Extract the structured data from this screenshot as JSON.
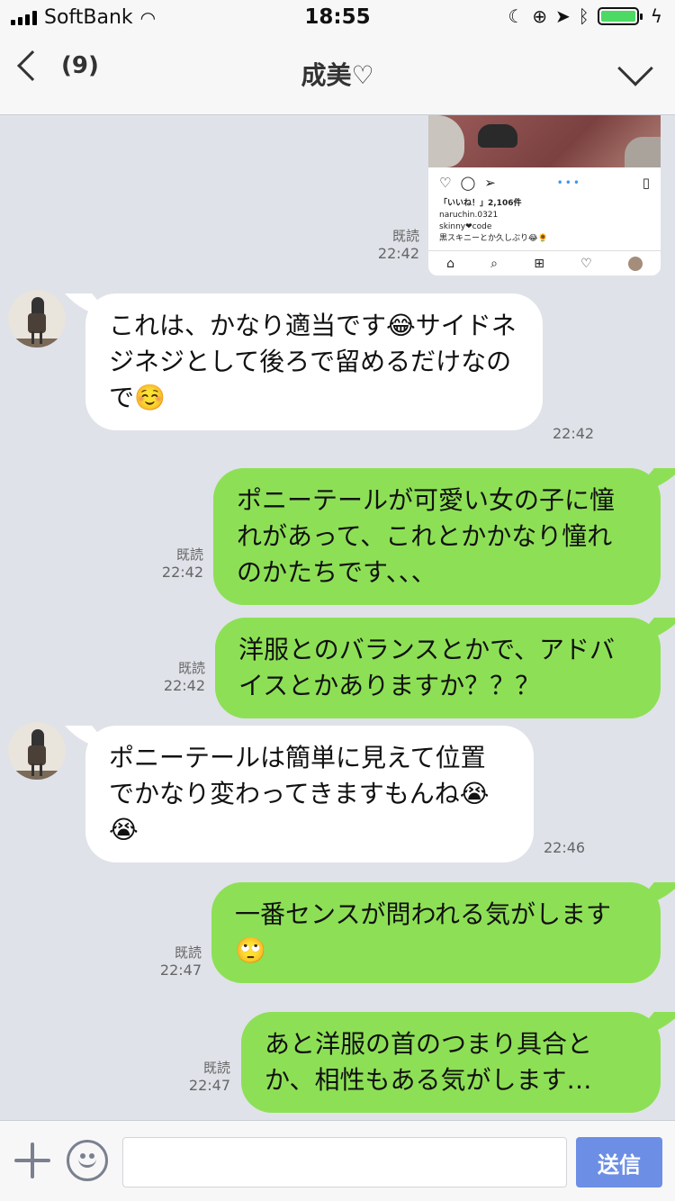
{
  "status_bar": {
    "carrier": "SoftBank",
    "time": "18:55",
    "battery_color": "#4cd964"
  },
  "nav": {
    "unread_count": "(9)",
    "title": "成美♡"
  },
  "image_message": {
    "likes": "「いいね！」2,106件",
    "username": "naruchin.0321",
    "caption_line1": "skinny❤code",
    "caption_line2": "黒スキニーとか久しぶり😂🌻",
    "read": "既読",
    "time": "22:42"
  },
  "messages": [
    {
      "side": "in",
      "text": "これは、かなり適当です😂サイドネジネジとして後ろで留めるだけなので☺️",
      "time": "22:42"
    },
    {
      "side": "out",
      "text": "ポニーテールが可愛い女の子に憧れがあって、これとかかなり憧れのかたちです、、、",
      "read": "既読",
      "time": "22:42"
    },
    {
      "side": "out",
      "text": "洋服とのバランスとかで、アドバイスとかありますか？？？",
      "read": "既読",
      "time": "22:42"
    },
    {
      "side": "in",
      "text": "ポニーテールは簡単に見えて位置でかなり変わってきますもんね😭😭",
      "time": "22:46"
    },
    {
      "side": "out",
      "text": "一番センスが問われる気がします🙄",
      "read": "既読",
      "time": "22:47"
    },
    {
      "side": "out",
      "text": "あと洋服の首のつまり具合とか、相性もある気がします…",
      "read": "既読",
      "time": "22:47"
    }
  ],
  "input_bar": {
    "placeholder": "",
    "send_label": "送信"
  },
  "colors": {
    "background": "#dfe2e8",
    "outgoing_bubble": "#8de055",
    "incoming_bubble": "#ffffff",
    "send_button": "#6c8ee4"
  }
}
